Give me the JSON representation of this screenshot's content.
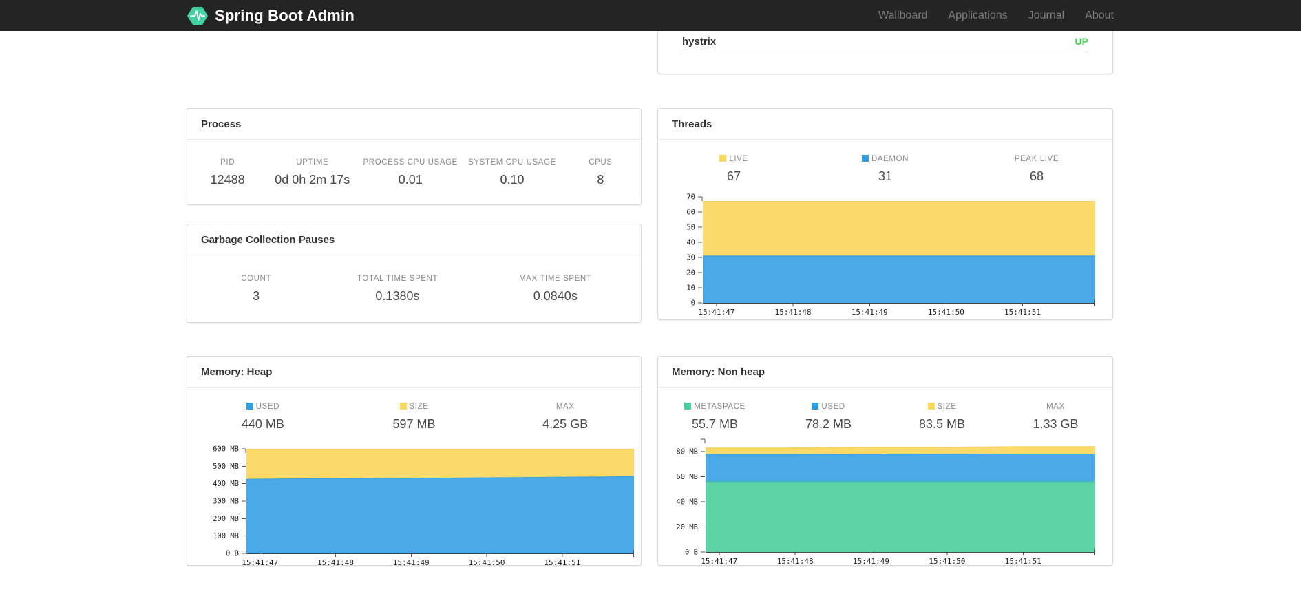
{
  "navbar": {
    "brand": "Spring Boot Admin",
    "logo_color": "#41d0a0",
    "links": [
      {
        "label": "Wallboard"
      },
      {
        "label": "Applications"
      },
      {
        "label": "Journal"
      },
      {
        "label": "About"
      }
    ]
  },
  "application": {
    "name": "hystrix",
    "status": "UP",
    "status_color": "#3bd04f"
  },
  "process": {
    "title": "Process",
    "stats": [
      {
        "label": "PID",
        "value": "12488"
      },
      {
        "label": "UPTIME",
        "value": "0d 0h 2m 17s"
      },
      {
        "label": "PROCESS CPU USAGE",
        "value": "0.01"
      },
      {
        "label": "SYSTEM CPU USAGE",
        "value": "0.10"
      },
      {
        "label": "CPUS",
        "value": "8"
      }
    ]
  },
  "gc": {
    "title": "Garbage Collection Pauses",
    "stats": [
      {
        "label": "COUNT",
        "value": "3"
      },
      {
        "label": "TOTAL TIME SPENT",
        "value": "0.1380s"
      },
      {
        "label": "MAX TIME SPENT",
        "value": "0.0840s"
      }
    ]
  },
  "threads": {
    "title": "Threads",
    "legend": [
      {
        "label": "LIVE",
        "value": "67",
        "color": "#fbd85c"
      },
      {
        "label": "DAEMON",
        "value": "31",
        "color": "#2f9fe1"
      },
      {
        "label": "PEAK LIVE",
        "value": "68",
        "color": null
      }
    ],
    "chart": {
      "type": "area",
      "ymax": 70,
      "y_ticks": [
        {
          "value": 0,
          "label": "0"
        },
        {
          "value": 10,
          "label": "10"
        },
        {
          "value": 20,
          "label": "20"
        },
        {
          "value": 30,
          "label": "30"
        },
        {
          "value": 40,
          "label": "40"
        },
        {
          "value": 50,
          "label": "50"
        },
        {
          "value": 60,
          "label": "60"
        },
        {
          "value": 70,
          "label": "70"
        }
      ],
      "x_ticks": [
        {
          "frac": 0.035,
          "label": "15:41:47"
        },
        {
          "frac": 0.23,
          "label": "15:41:48"
        },
        {
          "frac": 0.425,
          "label": "15:41:49"
        },
        {
          "frac": 0.62,
          "label": "15:41:50"
        },
        {
          "frac": 0.815,
          "label": "15:41:51"
        }
      ],
      "series": [
        {
          "name": "LIVE",
          "color": "#fbda6a",
          "line": "#f2ca4e",
          "values": [
            67,
            67,
            67,
            67,
            67,
            67
          ]
        },
        {
          "name": "DAEMON",
          "color": "#49aae7",
          "line": "#389fdf",
          "values": [
            31,
            31,
            31,
            31,
            31,
            31
          ]
        }
      ]
    }
  },
  "memory_heap": {
    "title": "Memory: Heap",
    "legend": [
      {
        "label": "USED",
        "value": "440 MB",
        "color": "#2f9fe1"
      },
      {
        "label": "SIZE",
        "value": "597 MB",
        "color": "#fbd85c"
      },
      {
        "label": "MAX",
        "value": "4.25 GB",
        "color": null
      }
    ],
    "chart": {
      "type": "area",
      "ymax": 600,
      "y_ticks": [
        {
          "value": 0,
          "label": "0 B"
        },
        {
          "value": 100,
          "label": "100 MB"
        },
        {
          "value": 200,
          "label": "200 MB"
        },
        {
          "value": 300,
          "label": "300 MB"
        },
        {
          "value": 400,
          "label": "400 MB"
        },
        {
          "value": 500,
          "label": "500 MB"
        },
        {
          "value": 600,
          "label": "600 MB"
        }
      ],
      "x_ticks": [
        {
          "frac": 0.035,
          "label": "15:41:47"
        },
        {
          "frac": 0.23,
          "label": "15:41:48"
        },
        {
          "frac": 0.425,
          "label": "15:41:49"
        },
        {
          "frac": 0.62,
          "label": "15:41:50"
        },
        {
          "frac": 0.815,
          "label": "15:41:51"
        }
      ],
      "series": [
        {
          "name": "SIZE",
          "color": "#fbda6a",
          "line": "#f2ca4e",
          "values": [
            597,
            597,
            597,
            597,
            597,
            597
          ]
        },
        {
          "name": "USED",
          "color": "#49aae7",
          "line": "#389fdf",
          "values": [
            426,
            429,
            431,
            434,
            437,
            441
          ]
        }
      ]
    }
  },
  "memory_nonheap": {
    "title": "Memory: Non heap",
    "legend": [
      {
        "label": "METASPACE",
        "value": "55.7 MB",
        "color": "#45ce9a"
      },
      {
        "label": "USED",
        "value": "78.2 MB",
        "color": "#2f9fe1"
      },
      {
        "label": "SIZE",
        "value": "83.5 MB",
        "color": "#fbd85c"
      },
      {
        "label": "MAX",
        "value": "1.33 GB",
        "color": null
      }
    ],
    "chart": {
      "type": "area",
      "ymax": 90,
      "y_ticks": [
        {
          "value": 0,
          "label": "0 B"
        },
        {
          "value": 20,
          "label": "20 MB"
        },
        {
          "value": 40,
          "label": "40 MB"
        },
        {
          "value": 60,
          "label": "60 MB"
        },
        {
          "value": 80,
          "label": "80 MB"
        }
      ],
      "x_ticks": [
        {
          "frac": 0.035,
          "label": "15:41:47"
        },
        {
          "frac": 0.23,
          "label": "15:41:48"
        },
        {
          "frac": 0.425,
          "label": "15:41:49"
        },
        {
          "frac": 0.62,
          "label": "15:41:50"
        },
        {
          "frac": 0.815,
          "label": "15:41:51"
        }
      ],
      "series": [
        {
          "name": "SIZE",
          "color": "#fbda6a",
          "line": "#f2ca4e",
          "values": [
            83,
            83,
            83.6,
            83.6,
            84,
            84
          ]
        },
        {
          "name": "USED",
          "color": "#49aae7",
          "line": "#389fdf",
          "values": [
            77.9,
            77.9,
            78,
            78.1,
            78.2,
            78.2
          ]
        },
        {
          "name": "METASPACE",
          "color": "#5cd4a6",
          "line": "#49c795",
          "values": [
            55.9,
            55.9,
            55.9,
            55.9,
            55.9,
            55.9
          ]
        }
      ]
    }
  }
}
